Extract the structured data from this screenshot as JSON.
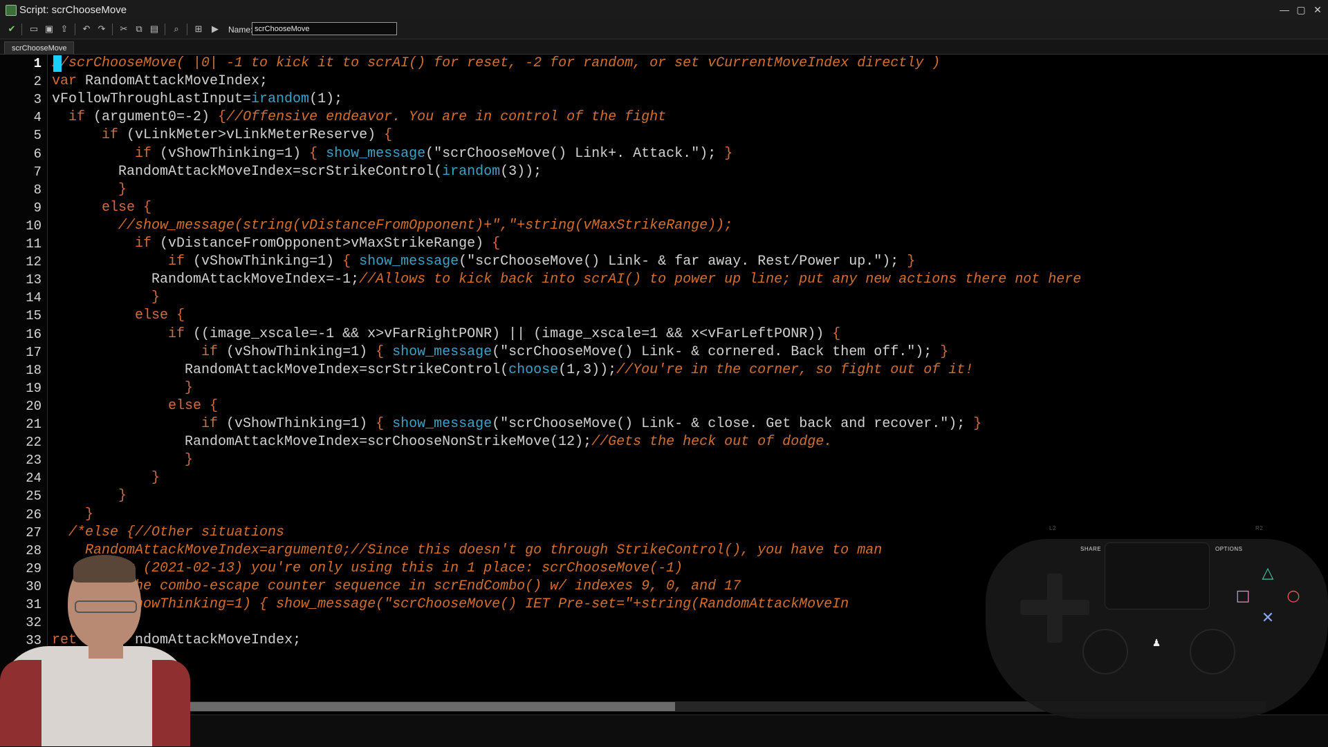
{
  "window": {
    "title": "Script: scrChooseMove",
    "minimize": "—",
    "maximize": "▢",
    "close": "✕"
  },
  "toolbar": {
    "name_label": "Name:",
    "name_value": "scrChooseMove",
    "icons": [
      "check-icon",
      "open-icon",
      "save-icon",
      "export-icon",
      "undo-icon",
      "redo-icon",
      "cut-icon",
      "copy-icon",
      "paste-icon",
      "search-icon",
      "grid-icon",
      "print-icon"
    ]
  },
  "tab": {
    "label": "scrChooseMove"
  },
  "editor": {
    "current_line": 1,
    "line_numbers": [
      "1",
      "2",
      "3",
      "4",
      "5",
      "6",
      "7",
      "8",
      "9",
      "10",
      "11",
      "12",
      "13",
      "14",
      "15",
      "16",
      "17",
      "18",
      "19",
      "20",
      "21",
      "22",
      "23",
      "24",
      "25",
      "26",
      "27",
      "28",
      "29",
      "30",
      "31",
      "32",
      "33",
      "34"
    ],
    "lines": [
      [
        {
          "t": "//scrChooseMove( |0| -1 to kick it to scrAI() for reset, -2 for random, or set vCurrentMoveIndex directly )",
          "c": "cm"
        }
      ],
      [
        {
          "t": "var ",
          "c": "kw"
        },
        {
          "t": "RandomAttackMoveIndex;",
          "c": "tx"
        }
      ],
      [
        {
          "t": "vFollowThroughLastInput=",
          "c": "tx"
        },
        {
          "t": "irandom",
          "c": "fn"
        },
        {
          "t": "(1);",
          "c": "tx"
        }
      ],
      [
        {
          "t": "  if ",
          "c": "kw"
        },
        {
          "t": "(argument0=-2) ",
          "c": "tx"
        },
        {
          "t": "{",
          "c": "kw"
        },
        {
          "t": "//Offensive endeavor. You are in control of the fight",
          "c": "cm"
        }
      ],
      [
        {
          "t": "      if ",
          "c": "kw"
        },
        {
          "t": "(vLinkMeter>vLinkMeterReserve) ",
          "c": "tx"
        },
        {
          "t": "{",
          "c": "kw"
        }
      ],
      [
        {
          "t": "          if ",
          "c": "kw"
        },
        {
          "t": "(vShowThinking=1) ",
          "c": "tx"
        },
        {
          "t": "{ ",
          "c": "kw"
        },
        {
          "t": "show_message",
          "c": "fn"
        },
        {
          "t": "(\"scrChooseMove() Link+. Attack.\"); ",
          "c": "tx"
        },
        {
          "t": "}",
          "c": "kw"
        }
      ],
      [
        {
          "t": "        RandomAttackMoveIndex=scrStrikeControl(",
          "c": "tx"
        },
        {
          "t": "irandom",
          "c": "fn"
        },
        {
          "t": "(3));",
          "c": "tx"
        }
      ],
      [
        {
          "t": "        }",
          "c": "kw"
        }
      ],
      [
        {
          "t": "      else ",
          "c": "kw"
        },
        {
          "t": "{",
          "c": "kw"
        }
      ],
      [
        {
          "t": "        //show_message(string(vDistanceFromOpponent)+\",\"+string(vMaxStrikeRange));",
          "c": "cm"
        }
      ],
      [
        {
          "t": "          if ",
          "c": "kw"
        },
        {
          "t": "(vDistanceFromOpponent>vMaxStrikeRange) ",
          "c": "tx"
        },
        {
          "t": "{",
          "c": "kw"
        }
      ],
      [
        {
          "t": "              if ",
          "c": "kw"
        },
        {
          "t": "(vShowThinking=1) ",
          "c": "tx"
        },
        {
          "t": "{ ",
          "c": "kw"
        },
        {
          "t": "show_message",
          "c": "fn"
        },
        {
          "t": "(\"scrChooseMove() Link- & far away. Rest/Power up.\"); ",
          "c": "tx"
        },
        {
          "t": "}",
          "c": "kw"
        }
      ],
      [
        {
          "t": "            RandomAttackMoveIndex=-1;",
          "c": "tx"
        },
        {
          "t": "//Allows to kick back into scrAI() to power up line; put any new actions there not here",
          "c": "cm"
        }
      ],
      [
        {
          "t": "            }",
          "c": "kw"
        }
      ],
      [
        {
          "t": "          else ",
          "c": "kw"
        },
        {
          "t": "{",
          "c": "kw"
        }
      ],
      [
        {
          "t": "              if ",
          "c": "kw"
        },
        {
          "t": "((image_xscale=-1 && x>vFarRightPONR) || (image_xscale=1 && x<vFarLeftPONR)) ",
          "c": "tx"
        },
        {
          "t": "{",
          "c": "kw"
        }
      ],
      [
        {
          "t": "                  if ",
          "c": "kw"
        },
        {
          "t": "(vShowThinking=1) ",
          "c": "tx"
        },
        {
          "t": "{ ",
          "c": "kw"
        },
        {
          "t": "show_message",
          "c": "fn"
        },
        {
          "t": "(\"scrChooseMove() Link- & cornered. Back them off.\"); ",
          "c": "tx"
        },
        {
          "t": "}",
          "c": "kw"
        }
      ],
      [
        {
          "t": "                RandomAttackMoveIndex=scrStrikeControl(",
          "c": "tx"
        },
        {
          "t": "choose",
          "c": "fn"
        },
        {
          "t": "(1,3));",
          "c": "tx"
        },
        {
          "t": "//You're in the corner, so fight out of it!",
          "c": "cm"
        }
      ],
      [
        {
          "t": "                }",
          "c": "kw"
        }
      ],
      [
        {
          "t": "              else ",
          "c": "kw"
        },
        {
          "t": "{",
          "c": "kw"
        }
      ],
      [
        {
          "t": "                  if ",
          "c": "kw"
        },
        {
          "t": "(vShowThinking=1) ",
          "c": "tx"
        },
        {
          "t": "{ ",
          "c": "kw"
        },
        {
          "t": "show_message",
          "c": "fn"
        },
        {
          "t": "(\"scrChooseMove() Link- & close. Get back and recover.\"); ",
          "c": "tx"
        },
        {
          "t": "}",
          "c": "kw"
        }
      ],
      [
        {
          "t": "                RandomAttackMoveIndex=scrChooseNonStrikeMove(12);",
          "c": "tx"
        },
        {
          "t": "//Gets the heck out of dodge.",
          "c": "cm"
        }
      ],
      [
        {
          "t": "                }",
          "c": "kw"
        }
      ],
      [
        {
          "t": "            }",
          "c": "kw"
        }
      ],
      [
        {
          "t": "        }",
          "c": "kw"
        }
      ],
      [
        {
          "t": "    }",
          "c": "kw"
        }
      ],
      [
        {
          "t": "  /*else {//Other situations",
          "c": "cm"
        }
      ],
      [
        {
          "t": "    RandomAttackMoveIndex=argument0;//Since this doesn't go through StrikeControl(), you have to man",
          "c": "cm"
        }
      ],
      [
        {
          "t": "       far (2021-02-13) you're only using this in 1 place: scrChooseMove(-1)",
          "c": "cm"
        }
      ],
      [
        {
          "t": "       . The combo-escape counter sequence in scrEndCombo() w/ indexes 9, 0, and 17",
          "c": "cm"
        }
      ],
      [
        {
          "t": "       (vShowThinking=1) { show_message(\"scrChooseMove() IET Pre-set=\"+string(RandomAttackMoveIn",
          "c": "cm"
        }
      ],
      [],
      [
        {
          "t": "ret",
          "c": "kw"
        },
        {
          "t": "       ndomAttackMoveIndex;",
          "c": "tx"
        }
      ],
      []
    ]
  },
  "overlay_controller": {
    "share_label": "SHARE",
    "options_label": "OPTIONS",
    "l2_label": "L2",
    "r2_label": "R2"
  }
}
